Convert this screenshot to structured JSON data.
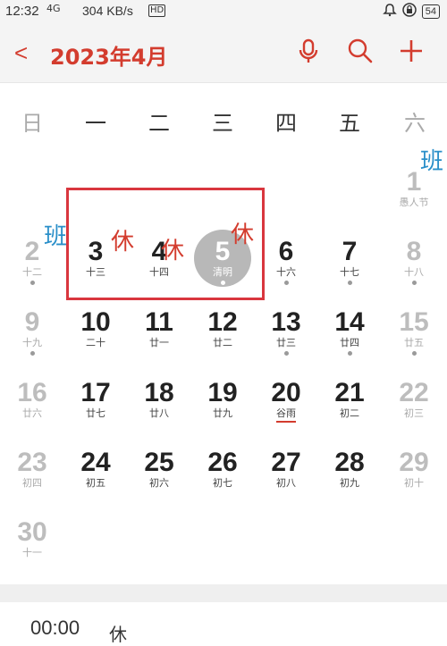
{
  "status": {
    "time": "12:32",
    "net": "4G",
    "speed": "304 KB/s",
    "hd": "HD",
    "battery": "54"
  },
  "header": {
    "back": "<",
    "title": "2023年4月"
  },
  "weekdays": [
    "日",
    "一",
    "二",
    "三",
    "四",
    "五",
    "六"
  ],
  "tags": {
    "ban": "班",
    "xiu": "休"
  },
  "days": {
    "d1": {
      "num": "1",
      "lunar": "愚人节"
    },
    "d2": {
      "num": "2",
      "lunar": "十二"
    },
    "d3": {
      "num": "3",
      "lunar": "十三"
    },
    "d4": {
      "num": "4",
      "lunar": "十四"
    },
    "d5": {
      "num": "5",
      "lunar": "清明"
    },
    "d6": {
      "num": "6",
      "lunar": "十六"
    },
    "d7": {
      "num": "7",
      "lunar": "十七"
    },
    "d8": {
      "num": "8",
      "lunar": "十八"
    },
    "d9": {
      "num": "9",
      "lunar": "十九"
    },
    "d10": {
      "num": "10",
      "lunar": "二十"
    },
    "d11": {
      "num": "11",
      "lunar": "廿一"
    },
    "d12": {
      "num": "12",
      "lunar": "廿二"
    },
    "d13": {
      "num": "13",
      "lunar": "廿三"
    },
    "d14": {
      "num": "14",
      "lunar": "廿四"
    },
    "d15": {
      "num": "15",
      "lunar": "廿五"
    },
    "d16": {
      "num": "16",
      "lunar": "廿六"
    },
    "d17": {
      "num": "17",
      "lunar": "廿七"
    },
    "d18": {
      "num": "18",
      "lunar": "廿八"
    },
    "d19": {
      "num": "19",
      "lunar": "廿九"
    },
    "d20": {
      "num": "20",
      "lunar": "谷雨"
    },
    "d21": {
      "num": "21",
      "lunar": "初二"
    },
    "d22": {
      "num": "22",
      "lunar": "初三"
    },
    "d23": {
      "num": "23",
      "lunar": "初四"
    },
    "d24": {
      "num": "24",
      "lunar": "初五"
    },
    "d25": {
      "num": "25",
      "lunar": "初六"
    },
    "d26": {
      "num": "26",
      "lunar": "初七"
    },
    "d27": {
      "num": "27",
      "lunar": "初八"
    },
    "d28": {
      "num": "28",
      "lunar": "初九"
    },
    "d29": {
      "num": "29",
      "lunar": "初十"
    },
    "d30": {
      "num": "30",
      "lunar": "十一"
    }
  },
  "event": {
    "time": "00:00",
    "rest": "休"
  },
  "colors": {
    "accent": "#d33c2e",
    "work": "#2a8fc9",
    "weekend": "#bdbdbd"
  },
  "icons": {
    "mic": "microphone-icon",
    "search": "search-icon",
    "add": "plus-icon"
  }
}
